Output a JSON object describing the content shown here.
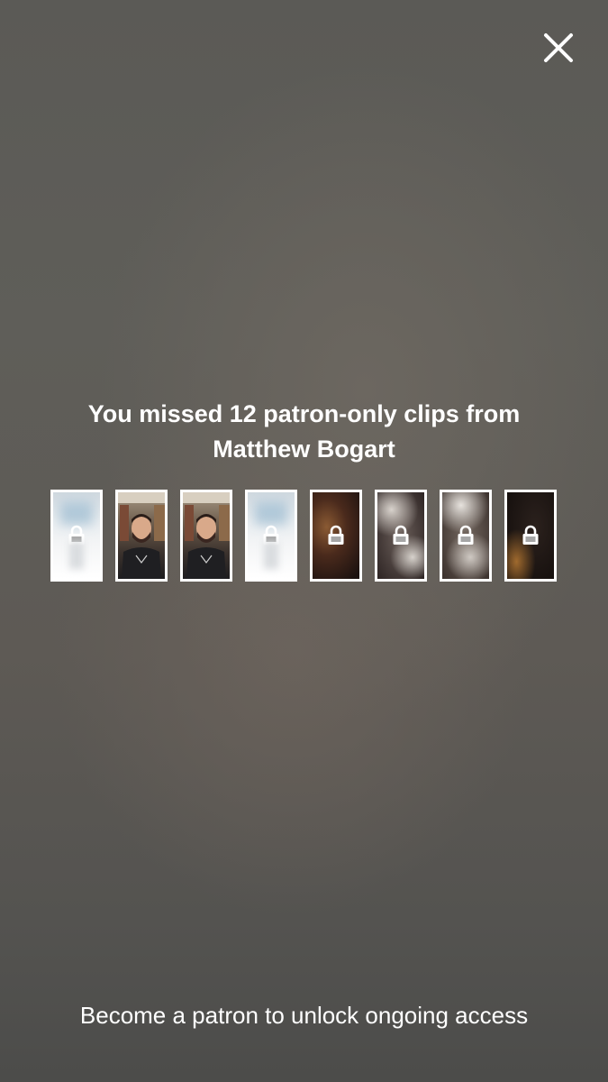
{
  "headline": "You missed 12 patron-only clips from Matthew Bogart",
  "clips": [
    {
      "style": "light",
      "locked": true
    },
    {
      "style": "person",
      "locked": false
    },
    {
      "style": "person",
      "locked": false
    },
    {
      "style": "light",
      "locked": true
    },
    {
      "style": "amber",
      "locked": true
    },
    {
      "style": "smoke1",
      "locked": true
    },
    {
      "style": "smoke2",
      "locked": true
    },
    {
      "style": "dark",
      "locked": true
    }
  ],
  "cta_label": "Become a patron to unlock ongoing access",
  "icons": {
    "close": "close-icon",
    "lock": "lock-icon"
  },
  "colors": {
    "text": "#ffffff",
    "background": "#5e5c58"
  }
}
